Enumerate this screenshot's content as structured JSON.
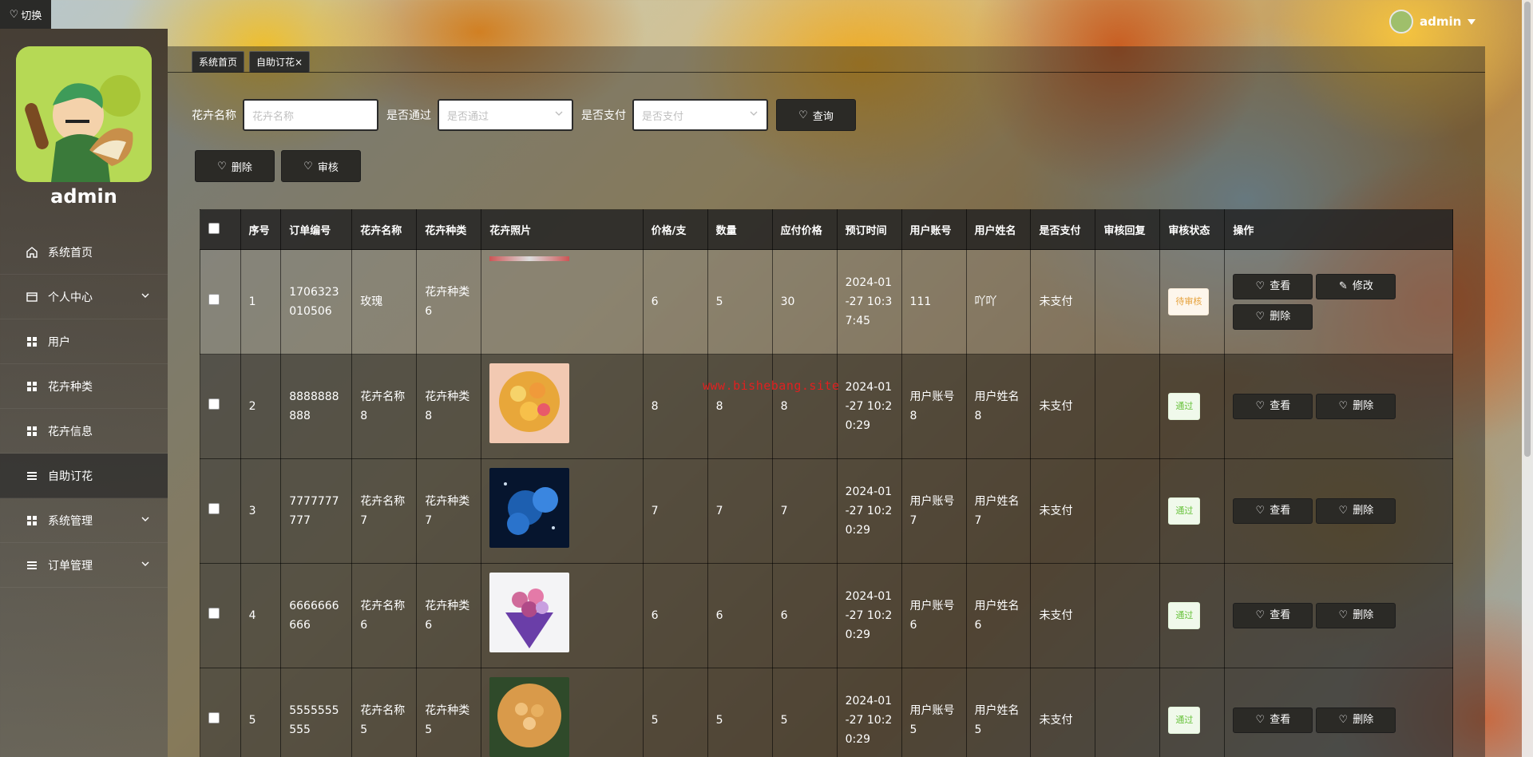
{
  "switch_label": "切换",
  "sidebar": {
    "username": "admin",
    "items": [
      {
        "label": "系统首页",
        "icon": "home-icon"
      },
      {
        "label": "个人中心",
        "icon": "card-icon",
        "expand": true
      },
      {
        "label": "用户",
        "icon": "grid-icon"
      },
      {
        "label": "花卉种类",
        "icon": "grid-icon"
      },
      {
        "label": "花卉信息",
        "icon": "grid-icon"
      },
      {
        "label": "自助订花",
        "icon": "list-icon",
        "active": true
      },
      {
        "label": "系统管理",
        "icon": "grid-icon",
        "expand": true
      },
      {
        "label": "订单管理",
        "icon": "list-icon",
        "expand": true
      }
    ]
  },
  "header": {
    "username": "admin"
  },
  "breadcrumb": {
    "home": "系统首页",
    "current": "自助订花",
    "close": "×"
  },
  "search": {
    "name_label": "花卉名称",
    "name_placeholder": "花卉名称",
    "pass_label": "是否通过",
    "pass_placeholder": "是否通过",
    "paid_label": "是否支付",
    "paid_placeholder": "是否支付",
    "query_button": "查询"
  },
  "actions": {
    "delete": "删除",
    "audit": "审核"
  },
  "table": {
    "headers": [
      "序号",
      "订单编号",
      "花卉名称",
      "花卉种类",
      "花卉照片",
      "价格/支",
      "数量",
      "应付价格",
      "预订时间",
      "用户账号",
      "用户姓名",
      "是否支付",
      "审核回复",
      "审核状态",
      "操作"
    ],
    "rows": [
      {
        "index": "1",
        "order_no": "1706323010506",
        "name": "玫瑰",
        "kind": "花卉种类6",
        "price": "6",
        "qty": "5",
        "total": "30",
        "time": "2024-01-27 10:37:45",
        "account": "111",
        "username": "吖吖",
        "paid": "未支付",
        "reply": "",
        "status": "待审核",
        "photo_color": "#777"
      },
      {
        "index": "2",
        "order_no": "8888888888",
        "name": "花卉名称8",
        "kind": "花卉种类8",
        "price": "8",
        "qty": "8",
        "total": "8",
        "time": "2024-01-27 10:20:29",
        "account": "用户账号8",
        "username": "用户姓名8",
        "paid": "未支付",
        "reply": "",
        "status": "通过",
        "photo_color": "#e8a73a"
      },
      {
        "index": "3",
        "order_no": "7777777777",
        "name": "花卉名称7",
        "kind": "花卉种类7",
        "price": "7",
        "qty": "7",
        "total": "7",
        "time": "2024-01-27 10:20:29",
        "account": "用户账号7",
        "username": "用户姓名7",
        "paid": "未支付",
        "reply": "",
        "status": "通过",
        "photo_color": "#1d5fb0"
      },
      {
        "index": "4",
        "order_no": "6666666666",
        "name": "花卉名称6",
        "kind": "花卉种类6",
        "price": "6",
        "qty": "6",
        "total": "6",
        "time": "2024-01-27 10:20:29",
        "account": "用户账号6",
        "username": "用户姓名6",
        "paid": "未支付",
        "reply": "",
        "status": "通过",
        "photo_color": "#8d55b8"
      },
      {
        "index": "5",
        "order_no": "5555555555",
        "name": "花卉名称5",
        "kind": "花卉种类5",
        "price": "5",
        "qty": "5",
        "total": "5",
        "time": "2024-01-27 10:20:29",
        "account": "用户账号5",
        "username": "用户姓名5",
        "paid": "未支付",
        "reply": "",
        "status": "通过",
        "photo_color": "#d99a4a"
      }
    ],
    "op_view": "查看",
    "op_edit": "修改",
    "op_delete": "删除"
  },
  "watermark": "www.bishebang.site"
}
